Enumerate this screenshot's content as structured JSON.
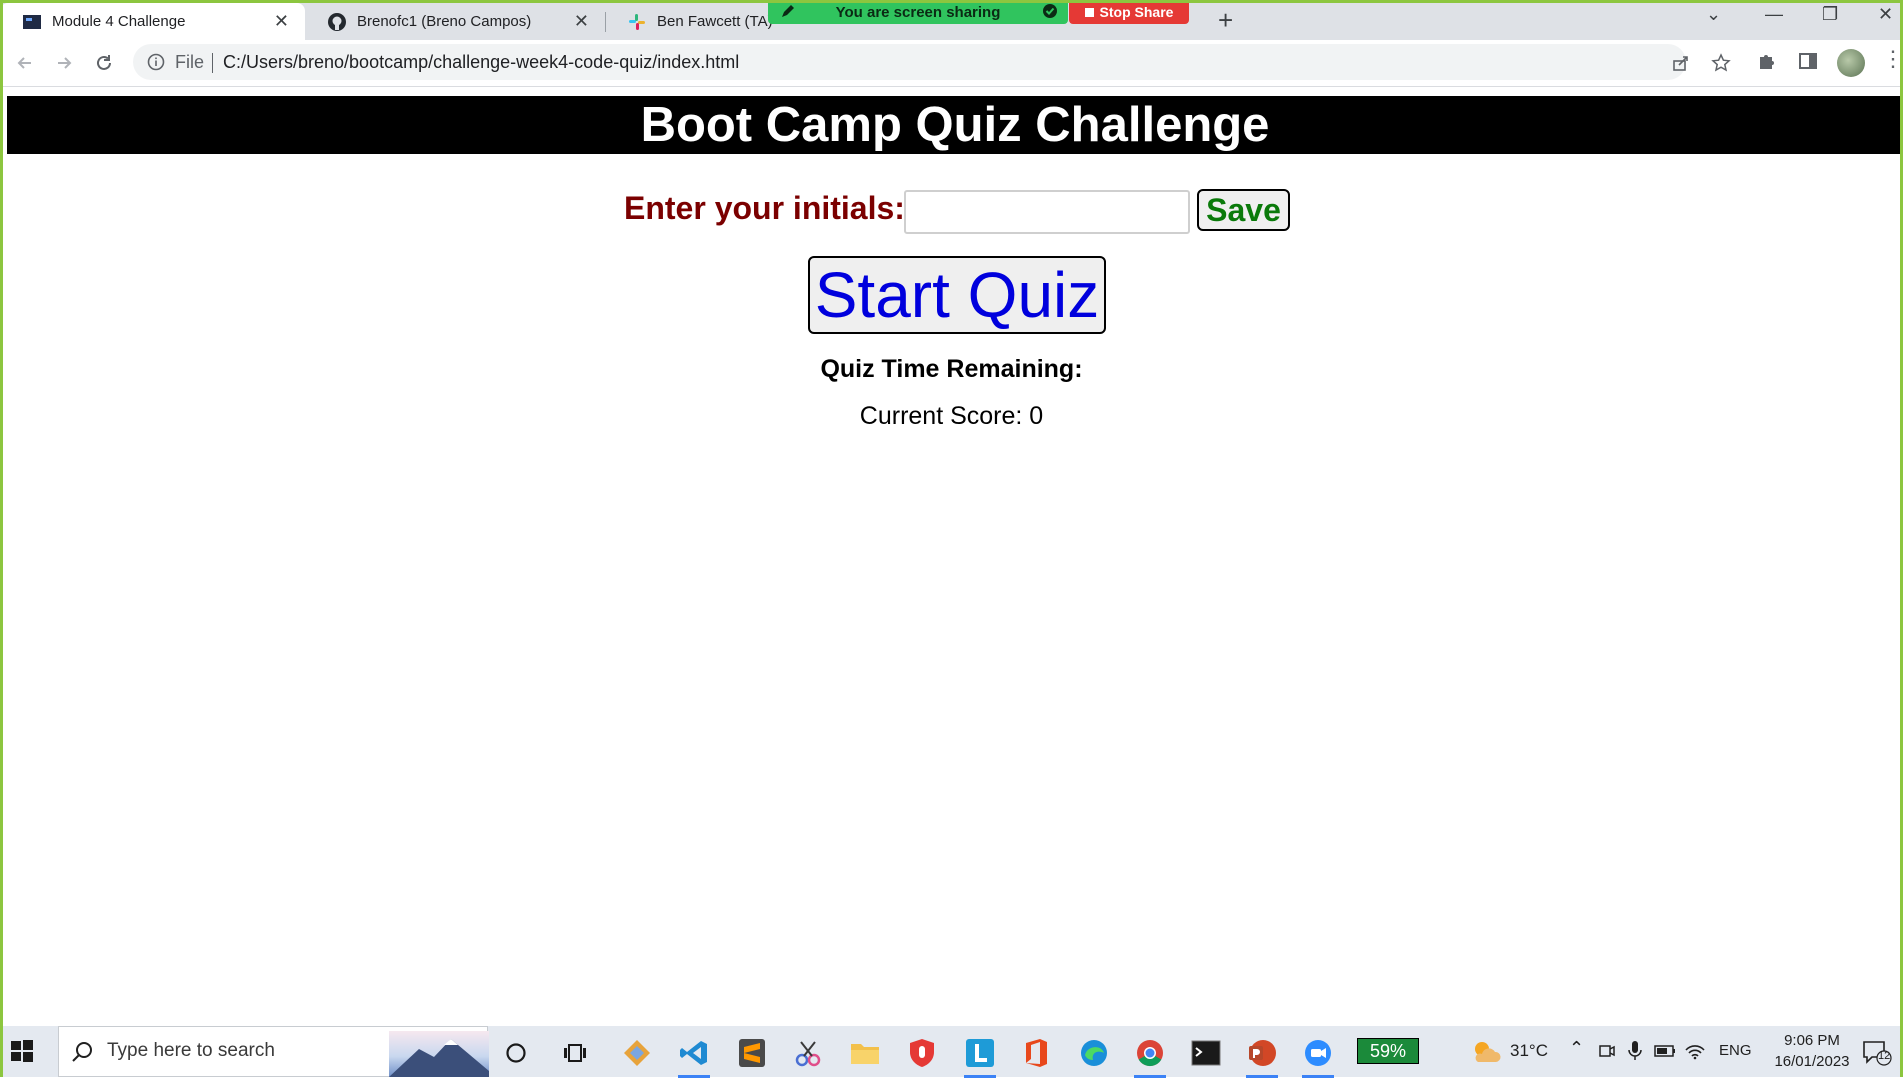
{
  "browser": {
    "tabs": [
      {
        "title": "Module 4 Challenge",
        "active": true
      },
      {
        "title": "Brenofc1 (Breno Campos)",
        "active": false
      },
      {
        "title": "Ben Fawcett (TA) -",
        "active": false
      }
    ],
    "tab_close_glyph": "✕",
    "new_tab_glyph": "+",
    "address": {
      "scheme_label": "File",
      "url": "C:/Users/breno/bootcamp/challenge-week4-code-quiz/index.html"
    }
  },
  "screen_share": {
    "banner_text": "You are screen sharing",
    "stop_label": "Stop Share"
  },
  "page": {
    "title": "Boot Camp Quiz Challenge",
    "initials_label": "Enter your initials:",
    "initials_value": "",
    "save_label": "Save",
    "start_label": "Start Quiz",
    "time_remaining": "Quiz Time Remaining:",
    "score": "Current Score: 0"
  },
  "taskbar": {
    "search_placeholder": "Type here to search",
    "battery": "59%",
    "temperature": "31°C",
    "language": "ENG",
    "time": "9:06 PM",
    "date": "16/01/2023",
    "notification_count": "12"
  },
  "colors": {
    "header_bg": "#000000",
    "header_text": "#ffffff",
    "initials_label": "#7b0000",
    "save_text": "#0a7a0a",
    "start_text": "#0000dd",
    "share_banner": "#30c45e",
    "stop_share": "#e53935",
    "frame": "#8cc63f"
  }
}
